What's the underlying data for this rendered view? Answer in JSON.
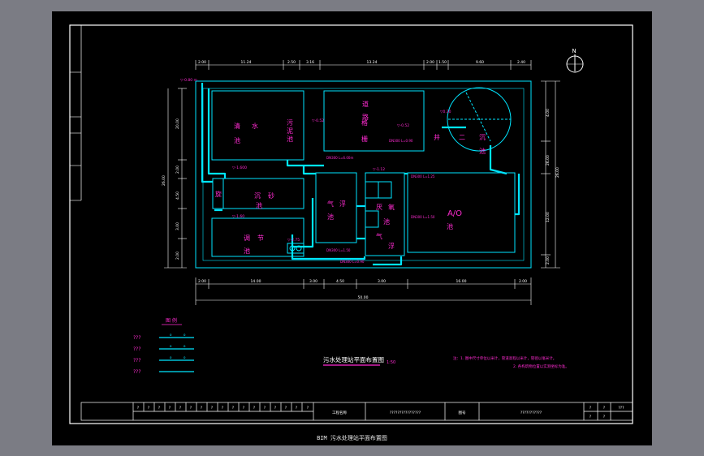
{
  "drawing": {
    "north_label": "N",
    "rooms": {
      "clear_water_1": "清",
      "clear_water_2": "水",
      "clear_water_3": "池",
      "sludge_1": "污",
      "sludge_2": "泥",
      "sludge_3": "池",
      "road_1": "道",
      "road_2": "路",
      "grille_1": "格",
      "grille_2": "栅",
      "secondary_1": "二",
      "secondary_2": "沉",
      "secondary_3": "池",
      "well": "井",
      "sediment_1": "沉",
      "sediment_2": "砂",
      "sediment_3": "池",
      "sediment_left": "旋",
      "adjust_1": "调",
      "adjust_2": "节",
      "adjust_3": "池",
      "aeration_1": "气",
      "aeration_2": "浮",
      "aeration_3": "池",
      "anaerobic_1": "厌",
      "anaerobic_2": "氧",
      "anaerobic_3": "池",
      "anaerobic_4": "气",
      "anaerobic_5": "浮",
      "ao_1": "A/O",
      "ao_2": "池"
    },
    "dims_top": [
      "2.00",
      "11.24",
      "2.50",
      "3.16",
      "13.24",
      "2.00",
      "1.50",
      "9.60",
      "2.40"
    ],
    "dims_bottom": [
      "2.00",
      "14.00",
      "3.00",
      "4.50",
      "3.00",
      "16.00",
      "2.00"
    ],
    "dim_bottom_total": "50.00",
    "dims_left": [
      "20.00",
      "2.00",
      "4.50",
      "3.00",
      "2.00"
    ],
    "dim_left_total": "26.00",
    "dims_right": [
      "4.00",
      "26.00",
      "12.00",
      "2.00"
    ],
    "dims_right_total": "26.00",
    "annotations": [
      "DN300 L=6.00m",
      "DN300 L=0.90",
      "DN300 L=1.25",
      "DN300 L=1.50",
      "DN300 L=1.50",
      "DN300 L=0.90"
    ],
    "legend_title": "图 例",
    "legend_rows": [
      "???",
      "???",
      "???",
      "???"
    ],
    "drawing_title": "污水处理站平面布置图",
    "drawing_scale": "1:50",
    "notes": [
      "注：1. 图中尺寸单位以米计，管道高程以米计，管径以毫米计。",
      "2. 各构筑物位置以实测坐标为准。"
    ]
  },
  "titleblock": {
    "cells": [
      "?",
      "?",
      "?",
      "?",
      "?",
      "?",
      "?",
      "?",
      "?",
      "?",
      "?",
      "?",
      "?",
      "?",
      "?",
      "?",
      "?"
    ],
    "design_label": "工程名称",
    "project_name": "????????????????",
    "sheet_label": "图号",
    "sheet_name": "???????????",
    "r1": "?",
    "r2": "?",
    "r3": "???",
    "r4": "?",
    "r5": "?"
  },
  "caption": "BIM 污水处理站平面布置图"
}
